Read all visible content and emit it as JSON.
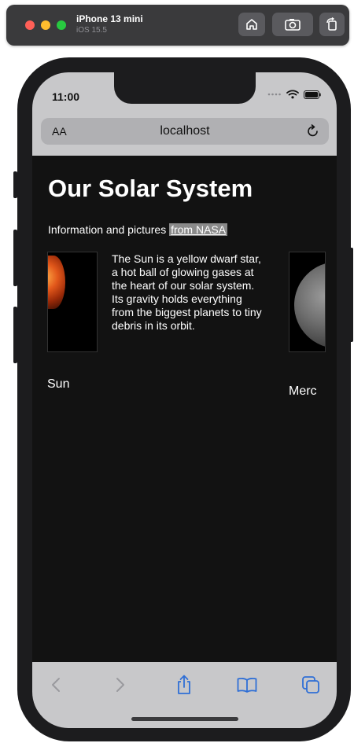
{
  "simulator": {
    "device_name": "iPhone 13 mini",
    "os_version": "iOS 15.5",
    "buttons": [
      "home-icon",
      "screenshot-icon",
      "rotate-icon"
    ]
  },
  "status_bar": {
    "time": "11:00",
    "icons": [
      "signal-dots-icon",
      "wifi-icon",
      "battery-icon"
    ]
  },
  "browser": {
    "text_size_label": "AA",
    "url": "localhost",
    "reload_icon": "reload-icon",
    "toolbar": [
      "back-icon",
      "forward-icon",
      "share-icon",
      "bookmarks-icon",
      "tabs-icon"
    ]
  },
  "page": {
    "title": "Our Solar System",
    "intro_text": "Information and pictures ",
    "intro_link": "from NASA",
    "planets": [
      {
        "name": "Sun",
        "description": "The Sun is a yellow dwarf star, a hot ball of glowing gases at the heart of our solar system. Its gravity holds everything from the biggest planets to tiny debris in its orbit."
      },
      {
        "name": "Merc"
      }
    ]
  },
  "colors": {
    "page_background": "#121212",
    "browser_chrome": "#c8c8ca",
    "link_highlight": "#8a8a8a",
    "toolbar_accent": "#2f6fd6",
    "toolbar_disabled": "#9a9a9e"
  }
}
